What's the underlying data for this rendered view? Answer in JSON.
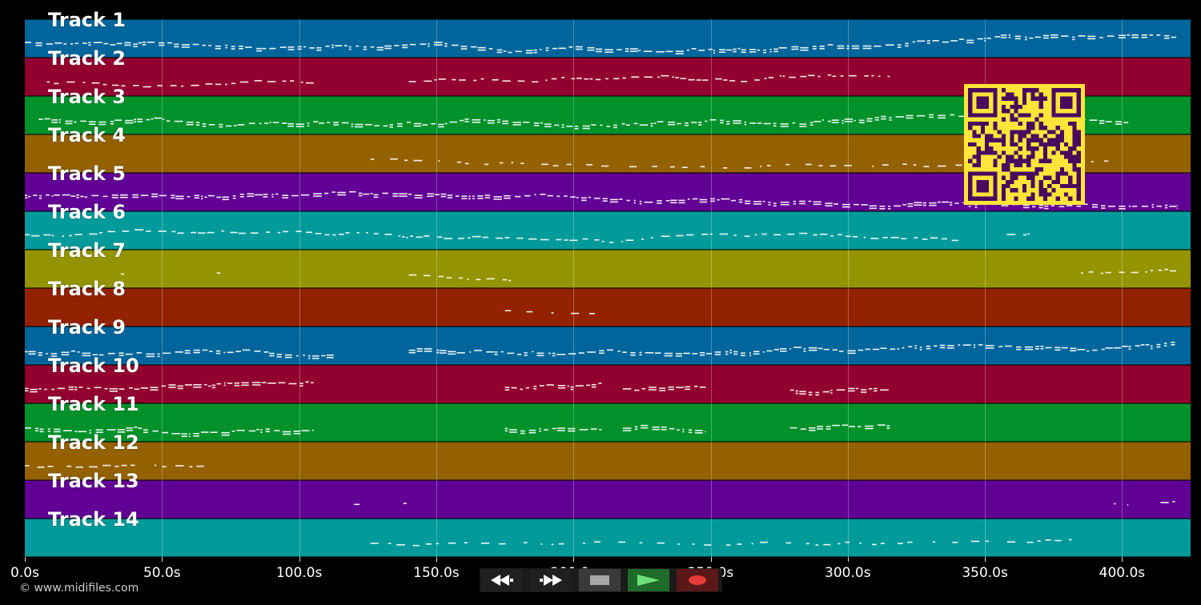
{
  "tracks": [
    {
      "label": "Track 1",
      "color": "#00659a"
    },
    {
      "label": "Track 2",
      "color": "#92002f"
    },
    {
      "label": "Track 3",
      "color": "#00912a"
    },
    {
      "label": "Track 4",
      "color": "#946100"
    },
    {
      "label": "Track 5",
      "color": "#610094"
    },
    {
      "label": "Track 6",
      "color": "#009a9a"
    },
    {
      "label": "Track 7",
      "color": "#949400"
    },
    {
      "label": "Track 8",
      "color": "#922200"
    },
    {
      "label": "Track 9",
      "color": "#00659a"
    },
    {
      "label": "Track 10",
      "color": "#92002f"
    },
    {
      "label": "Track 11",
      "color": "#00912a"
    },
    {
      "label": "Track 12",
      "color": "#946100"
    },
    {
      "label": "Track 13",
      "color": "#610094"
    },
    {
      "label": "Track 14",
      "color": "#009a9a"
    }
  ],
  "timeline": {
    "ticks": [
      {
        "value": 0,
        "label": "0.0s"
      },
      {
        "value": 50,
        "label": "50.0s"
      },
      {
        "value": 100,
        "label": "100.0s"
      },
      {
        "value": 150,
        "label": "150.0s"
      },
      {
        "value": 200,
        "label": "200.0s"
      },
      {
        "value": 250,
        "label": "250.0s"
      },
      {
        "value": 300,
        "label": "300.0s"
      },
      {
        "value": 350,
        "label": "350.0s"
      },
      {
        "value": 400,
        "label": "400.0s"
      }
    ],
    "max_seconds": 425.5
  },
  "copyright": "© www.midifiles.com",
  "qr": {
    "colors": {
      "bg": "#ffe53a",
      "fg": "#4a0b5e"
    }
  },
  "transport": {
    "rewind": {
      "icon": "rewind-icon",
      "bg": "#202020"
    },
    "forward": {
      "icon": "fast-forward-icon",
      "bg": "#202020"
    },
    "stop": {
      "icon": "stop-icon",
      "bg": "#3a3a3a"
    },
    "play": {
      "icon": "play-icon",
      "bg": "#1f6b2a"
    },
    "record": {
      "icon": "record-icon",
      "bg": "#5a1818"
    }
  },
  "note_activity": [
    {
      "track": 1,
      "ranges": [
        [
          0,
          420
        ]
      ],
      "density": "high"
    },
    {
      "track": 2,
      "ranges": [
        [
          8,
          107
        ],
        [
          140,
          315
        ]
      ],
      "density": "medium"
    },
    {
      "track": 3,
      "ranges": [
        [
          5,
          402
        ]
      ],
      "density": "high"
    },
    {
      "track": 4,
      "ranges": [
        [
          126,
          400
        ]
      ],
      "density": "low"
    },
    {
      "track": 5,
      "ranges": [
        [
          0,
          420
        ]
      ],
      "density": "high"
    },
    {
      "track": 6,
      "ranges": [
        [
          0,
          340
        ],
        [
          358,
          366
        ]
      ],
      "density": "medium"
    },
    {
      "track": 7,
      "ranges": [
        [
          35,
          36
        ],
        [
          70,
          71
        ],
        [
          140,
          177
        ],
        [
          385,
          420
        ]
      ],
      "density": "medium"
    },
    {
      "track": 8,
      "ranges": [
        [
          175,
          210
        ]
      ],
      "density": "low"
    },
    {
      "track": 9,
      "ranges": [
        [
          0,
          113
        ],
        [
          140,
          419
        ]
      ],
      "density": "high"
    },
    {
      "track": 10,
      "ranges": [
        [
          0,
          105
        ],
        [
          175,
          210
        ],
        [
          218,
          248
        ],
        [
          279,
          315
        ]
      ],
      "density": "high"
    },
    {
      "track": 11,
      "ranges": [
        [
          0,
          105
        ],
        [
          175,
          210
        ],
        [
          218,
          248
        ],
        [
          279,
          315
        ]
      ],
      "density": "high"
    },
    {
      "track": 12,
      "ranges": [
        [
          0,
          65
        ]
      ],
      "density": "low"
    },
    {
      "track": 13,
      "ranges": [
        [
          120,
          125
        ],
        [
          138,
          143
        ],
        [
          397,
          402
        ],
        [
          414,
          419
        ]
      ],
      "density": "low"
    },
    {
      "track": 14,
      "ranges": [
        [
          126,
          382
        ]
      ],
      "density": "low"
    }
  ]
}
